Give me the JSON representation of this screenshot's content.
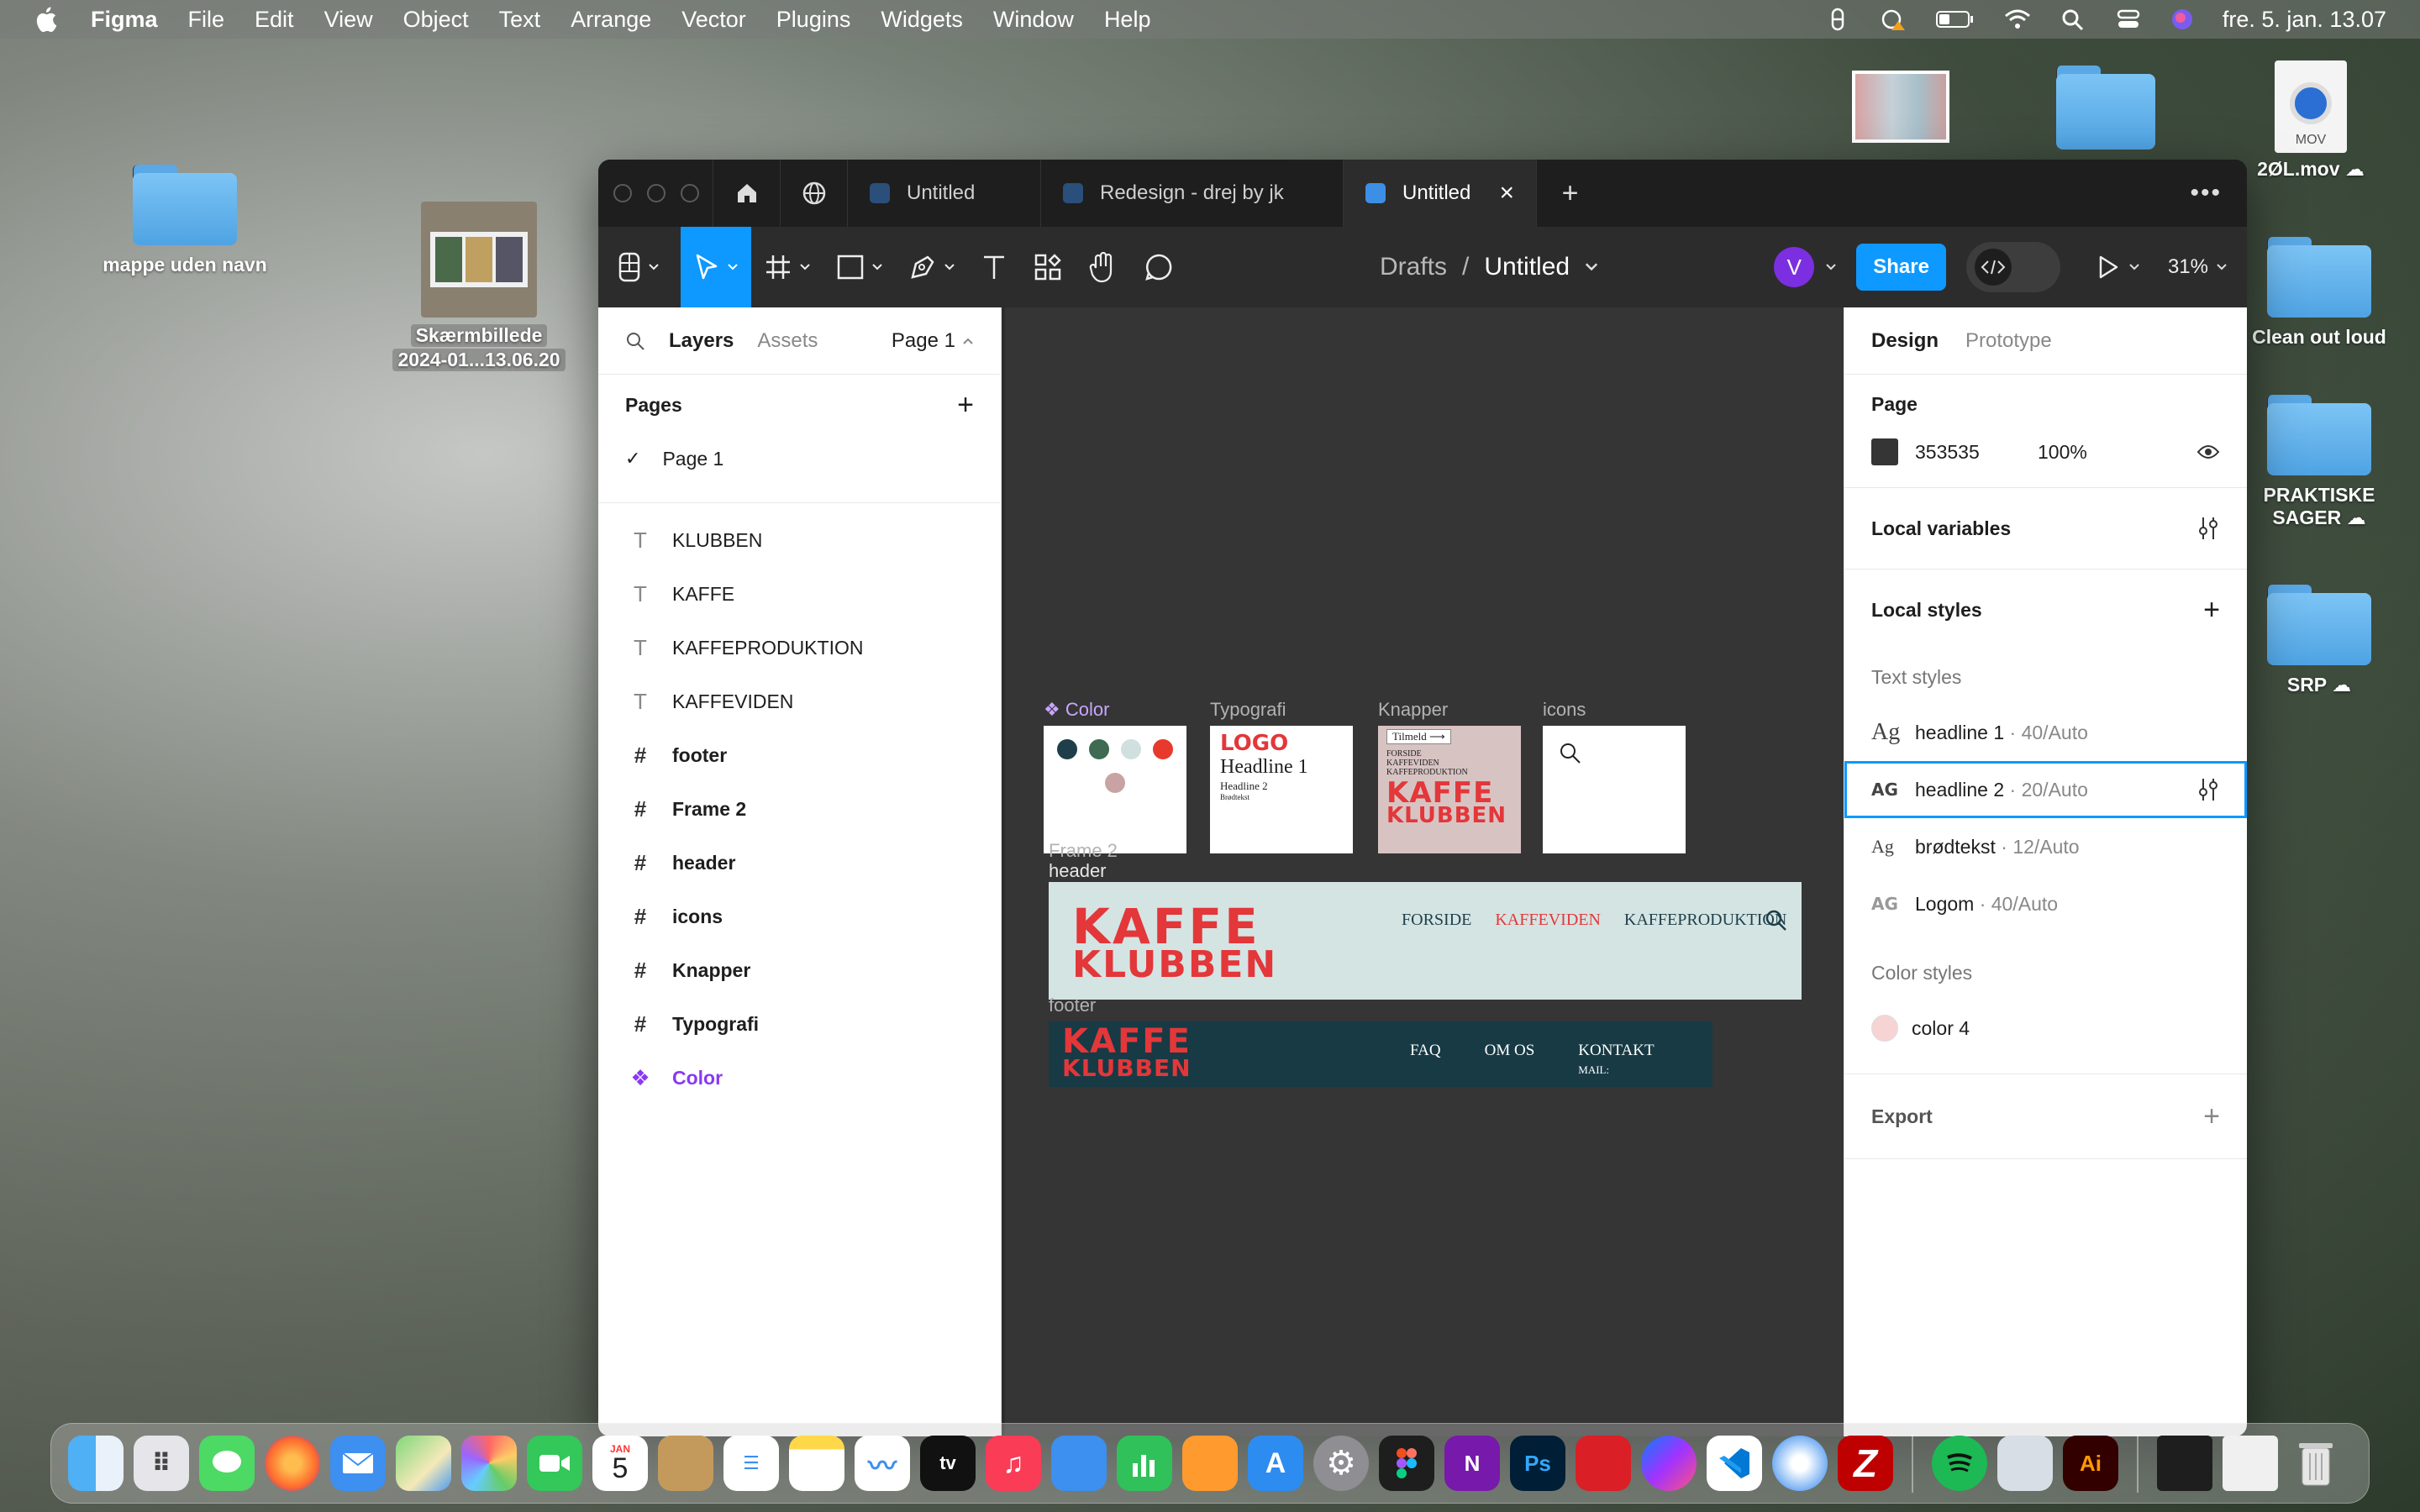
{
  "menubar": {
    "app": "Figma",
    "items": [
      "File",
      "Edit",
      "View",
      "Object",
      "Text",
      "Arrange",
      "Vector",
      "Plugins",
      "Widgets",
      "Window",
      "Help"
    ],
    "clock": "fre. 5. jan.  13.07"
  },
  "desktop": {
    "folder1": "mappe uden navn",
    "screenshot_line1": "Skærmbillede",
    "screenshot_line2": "2024-01...13.06.20",
    "mov_badge": "MOV",
    "mov_label": "2ØL.mov",
    "folder_clean": "Clean out loud",
    "folder_praktiske_1": "PRAKTISKE",
    "folder_praktiske_2": "SAGER",
    "folder_srp": "SRP"
  },
  "tabs": [
    {
      "label": "Untitled"
    },
    {
      "label": "Redesign - drej by jk"
    },
    {
      "label": "Untitled"
    }
  ],
  "toolbar": {
    "crumb_parent": "Drafts",
    "crumb_sep": "/",
    "crumb_file": "Untitled",
    "avatar": "V",
    "share": "Share",
    "zoom": "31%"
  },
  "left": {
    "tab_layers": "Layers",
    "tab_assets": "Assets",
    "page_selector": "Page 1",
    "pages_title": "Pages",
    "pages": [
      "Page 1"
    ],
    "layers": [
      {
        "icon": "T",
        "name": "KLUBBEN",
        "kind": "text"
      },
      {
        "icon": "T",
        "name": "KAFFE",
        "kind": "text"
      },
      {
        "icon": "T",
        "name": "KAFFEPRODUKTION",
        "kind": "text"
      },
      {
        "icon": "T",
        "name": "KAFFEVIDEN",
        "kind": "text"
      },
      {
        "icon": "#",
        "name": "footer",
        "kind": "frame"
      },
      {
        "icon": "#",
        "name": "Frame 2",
        "kind": "frame"
      },
      {
        "icon": "#",
        "name": "header",
        "kind": "frame"
      },
      {
        "icon": "#",
        "name": "icons",
        "kind": "frame"
      },
      {
        "icon": "#",
        "name": "Knapper",
        "kind": "frame"
      },
      {
        "icon": "#",
        "name": "Typografi",
        "kind": "frame"
      },
      {
        "icon": "❖",
        "name": "Color",
        "kind": "component"
      }
    ]
  },
  "canvas": {
    "color_label": "❖ Color",
    "typo_label": "Typografi",
    "knapper_label": "Knapper",
    "icons_label": "icons",
    "frame2_label": "Frame 2",
    "header_label": "header",
    "footer_label": "footer",
    "typo_logo": "LOGO",
    "typo_h1": "Headline 1",
    "typo_h2": "Headline 2",
    "typo_body": "Brødtekst",
    "btn_tilmeld": "Tilmeld",
    "btn_nav1": "FORSIDE",
    "btn_nav2": "KAFFEVIDEN",
    "btn_nav3": "KAFFEPRODUKTION",
    "logo_line1": "KAFFE",
    "logo_line2": "KLUBBEN",
    "nav_forside": "FORSIDE",
    "nav_kaffeviden": "KAFFEVIDEN",
    "nav_kaffeproduktion": "KAFFEPRODUKTION",
    "footer_faq": "FAQ",
    "footer_omos": "OM OS",
    "footer_kontakt": "KONTAKT",
    "footer_mail": "MAIL:",
    "swatches": [
      "#1e3f4a",
      "#3e6b52",
      "#cfe0df",
      "#e83a2c",
      "#c9a3a3"
    ]
  },
  "right": {
    "tab_design": "Design",
    "tab_prototype": "Prototype",
    "page_title": "Page",
    "page_color_hex": "353535",
    "page_opacity": "100%",
    "local_variables": "Local variables",
    "local_styles": "Local styles",
    "text_styles_title": "Text styles",
    "text_styles": [
      {
        "glyph": "Ag",
        "name": "headline 1",
        "meta": " · 40/Auto"
      },
      {
        "glyph": "AG",
        "name": "headline 2",
        "meta": " · 20/Auto"
      },
      {
        "glyph": "Ag",
        "name": "brødtekst",
        "meta": " · 12/Auto"
      },
      {
        "glyph": "AG",
        "name": "Logom",
        "meta": " · 40/Auto"
      }
    ],
    "color_styles_title": "Color styles",
    "color_style": "color 4",
    "export": "Export"
  },
  "colors": {
    "accent": "#0d99ff",
    "component": "#8a38f5",
    "canvas_bg": "#353535",
    "brand_red": "#e3373a",
    "header_bg": "#d4e4e3",
    "footer_bg": "#173a45"
  },
  "dock": {
    "calendar_month": "JAN",
    "calendar_day": "5"
  }
}
